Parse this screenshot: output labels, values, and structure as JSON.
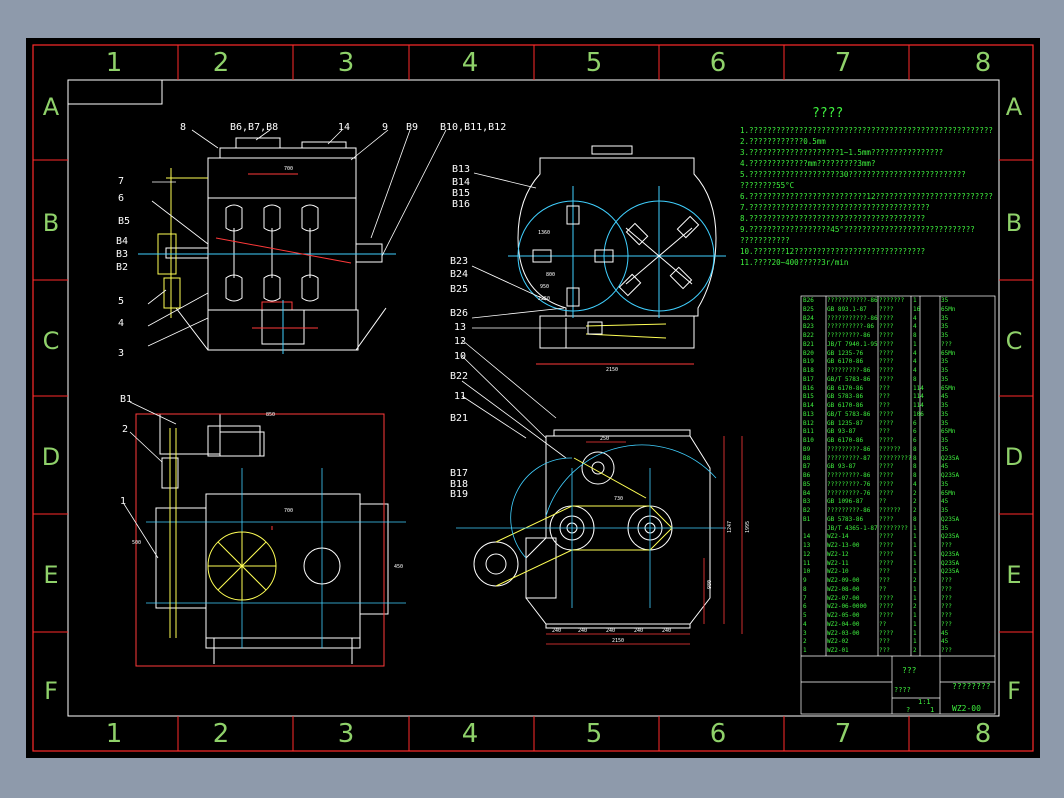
{
  "border_columns": [
    "1",
    "2",
    "3",
    "4",
    "5",
    "6",
    "7",
    "8"
  ],
  "border_rows": [
    "A",
    "B",
    "C",
    "D",
    "E",
    "F"
  ],
  "tech_requirements": {
    "title": "????",
    "lines": [
      "1.??????????????????????????????????????????????????????",
      "2.????????????0.5mm",
      "3.????????????????????1~1.5mm????????????????",
      "4.?????????????mm?????????3mm?",
      "5.????????????????????30??????????????????????????",
      "  ????????55°C",
      "6.??????????????????????????12??????????????????????????",
      "7.????????????????????????????????????????",
      "8.???????????????????????????????????????",
      "9.??????????????????45°?????????????????????????????",
      "  ???????????",
      "10.???????12?????????????????????????????",
      "11.????20~400?????3r/min"
    ]
  },
  "balloons_main": [
    "8",
    "B6,B7,B8",
    "14",
    "9",
    "B9",
    "B10,B11,B12",
    "7",
    "6",
    "B5",
    "B4",
    "B3",
    "B2",
    "5",
    "4",
    "3"
  ],
  "balloons_side": [
    "B13",
    "B14",
    "B15",
    "B16",
    "B23",
    "B24",
    "B25",
    "B26",
    "13",
    "12",
    "10",
    "B22",
    "11",
    "B21",
    "B17",
    "B18",
    "B19"
  ],
  "balloons_plan": [
    "B1",
    "2",
    "1"
  ],
  "bom_rows": [
    [
      "B26",
      "???????????-86",
      "???????",
      "1",
      "35"
    ],
    [
      "B25",
      "GB 893.1-87",
      "????",
      "16",
      "65Mn"
    ],
    [
      "B24",
      "???????????-86",
      "????",
      "4",
      "35"
    ],
    [
      "B23",
      "??????????-86",
      "????",
      "4",
      "35"
    ],
    [
      "B22",
      "?????????-86",
      "????",
      "8",
      "35"
    ],
    [
      "B21",
      "JB/T 7940.1-95",
      "????",
      "1",
      "???"
    ],
    [
      "B20",
      "GB 1235-76",
      "????",
      "4",
      "65Mn"
    ],
    [
      "B19",
      "GB 6170-86",
      "????",
      "4",
      "35"
    ],
    [
      "B18",
      "?????????-86",
      "????",
      "4",
      "35"
    ],
    [
      "B17",
      "GB/T 5783-86",
      "????",
      "8",
      "35"
    ],
    [
      "B16",
      "GB 6170-86",
      "???",
      "114",
      "65Mn"
    ],
    [
      "B15",
      "GB 5783-86",
      "???",
      "114",
      "45"
    ],
    [
      "B14",
      "GB 6170-86",
      "???",
      "114",
      "35"
    ],
    [
      "B13",
      "GB/T 5783-86",
      "????",
      "106",
      "35"
    ],
    [
      "B12",
      "GB 1235-87",
      "????",
      "6",
      "35"
    ],
    [
      "B11",
      "GB 93-87",
      "???",
      "6",
      "65Mn"
    ],
    [
      "B10",
      "GB 6170-86",
      "????",
      "6",
      "35"
    ],
    [
      "B9",
      "?????????-86",
      "??????",
      "8",
      "35"
    ],
    [
      "B8",
      "?????????-87",
      "?????????",
      "8",
      "Q235A"
    ],
    [
      "B7",
      "GB 93-87",
      "????",
      "8",
      "45"
    ],
    [
      "B6",
      "?????????-86",
      "????",
      "8",
      "Q235A"
    ],
    [
      "B5",
      "?????????-76",
      "????",
      "4",
      "35"
    ],
    [
      "B4",
      "?????????-76",
      "????",
      "2",
      "65Mn"
    ],
    [
      "B3",
      "GB 1096-87",
      "??",
      "2",
      "45"
    ],
    [
      "B2",
      "?????????-86",
      "??????",
      "2",
      "35"
    ],
    [
      "B1",
      "GB 5783-86",
      "????",
      "8",
      "Q235A"
    ],
    [
      "",
      "JB/T 4365-1-87",
      "????????",
      "1",
      "35"
    ],
    [
      "14",
      "WZ2-14",
      "????",
      "1",
      "Q235A"
    ],
    [
      "13",
      "WZ2-13-00",
      "????",
      "1",
      "???"
    ],
    [
      "12",
      "WZ2-12",
      "????",
      "1",
      "Q235A"
    ],
    [
      "11",
      "WZ2-11",
      "????",
      "1",
      "Q235A"
    ],
    [
      "10",
      "WZ2-10",
      "???",
      "1",
      "Q235A"
    ],
    [
      "9",
      "WZ2-09-00",
      "???",
      "2",
      "???"
    ],
    [
      "8",
      "WZ2-08-00",
      "??",
      "1",
      "???"
    ],
    [
      "7",
      "WZ2-07-00",
      "????",
      "1",
      "???"
    ],
    [
      "6",
      "WZ2-06-0000",
      "????",
      "2",
      "???"
    ],
    [
      "5",
      "WZ2-05-00",
      "????",
      "1",
      "???"
    ],
    [
      "4",
      "WZ2-04-00",
      "??",
      "1",
      "???"
    ],
    [
      "3",
      "WZ2-03-00",
      "????",
      "1",
      "45"
    ],
    [
      "2",
      "WZ2-02",
      "???",
      "1",
      "45"
    ],
    [
      "1",
      "WZ2-01",
      "???",
      "2",
      "???"
    ]
  ],
  "title_block": {
    "product_name": "???",
    "drawing_title": "????????",
    "drawing_number": "WZ2-00",
    "scale_label": "????",
    "scale_value": "1:1",
    "sheet_label": "?",
    "sheet_total": "1"
  },
  "dims_front": [
    "700"
  ],
  "dims_side": [
    "2150",
    "1360",
    "800",
    "950",
    "2250"
  ],
  "dims_plan": [
    "850",
    "700",
    "500",
    "450"
  ],
  "dims_end": [
    "250",
    "730",
    "1247",
    "1995",
    "980",
    "240",
    "240",
    "240",
    "240",
    "240",
    "2150"
  ]
}
